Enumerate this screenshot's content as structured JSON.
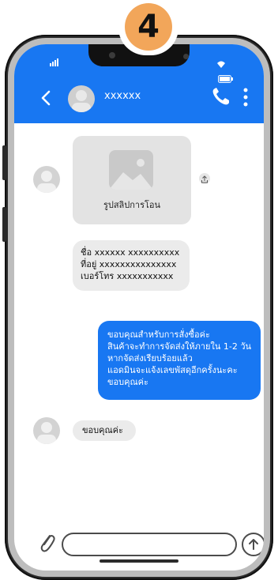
{
  "badge": {
    "step": "4"
  },
  "header": {
    "contact_name": "xxxxxx"
  },
  "messages": {
    "image_caption": "รูปสลิปการโอน",
    "info_lines": [
      "ชื่อ xxxxxx xxxxxxxxxx",
      "ที่อยู่ xxxxxxxxxxxxxxx",
      "เบอร์โทร xxxxxxxxxxx"
    ],
    "reply_lines": [
      "ขอบคุณสำหรับการสั่งซื้อค่ะ",
      "สินค้าจะทำการจัดส่งให้ภายใน 1-2 วัน",
      "หากจัดส่งเรียบร้อยแล้ว",
      "แอดมินจะแจ้งเลขพัสดุอีกครั้งนะคะ",
      "ขอบคุณค่ะ"
    ],
    "thanks": "ขอบคุณค่ะ"
  },
  "colors": {
    "accent": "#1877f2",
    "badge": "#f2a65a"
  },
  "icons": [
    "signal-icon",
    "wifi-icon",
    "battery-icon",
    "back-icon",
    "phone-call-icon",
    "menu-icon",
    "image-icon",
    "share-icon",
    "attach-icon",
    "send-icon"
  ]
}
